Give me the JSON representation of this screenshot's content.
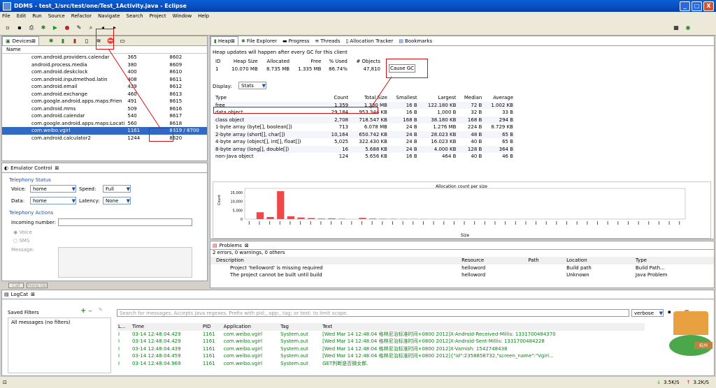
{
  "window": {
    "title": "DDMS - test_1/src/test/one/Test_1Activity.java - Eclipse",
    "min": "_",
    "max": "□",
    "close": "X"
  },
  "menu": [
    "File",
    "Edit",
    "Run",
    "Source",
    "Refactor",
    "Navigate",
    "Search",
    "Project",
    "Window",
    "Help"
  ],
  "devices": {
    "tab": "Devices",
    "col_name": "Name",
    "rows": [
      {
        "name": "com.android.providers.calendar",
        "pid": "365",
        "port": "8602"
      },
      {
        "name": "android.process.media",
        "pid": "380",
        "port": "8609"
      },
      {
        "name": "com.android.deskclock",
        "pid": "400",
        "port": "8610"
      },
      {
        "name": "com.android.inputmethod.latin",
        "pid": "408",
        "port": "8611"
      },
      {
        "name": "com.android.email",
        "pid": "439",
        "port": "8612"
      },
      {
        "name": "com.android.exchange",
        "pid": "460",
        "port": "8613"
      },
      {
        "name": "com.google.android.apps.maps:Frien",
        "pid": "491",
        "port": "8615"
      },
      {
        "name": "com.android.mms",
        "pid": "509",
        "port": "8616"
      },
      {
        "name": "com.android.calendar",
        "pid": "540",
        "port": "8617"
      },
      {
        "name": "com.google.android.apps.maps:Locati",
        "pid": "560",
        "port": "8618"
      },
      {
        "name": "com.weibo.vgirl",
        "pid": "1161",
        "port": "8619 / 8700"
      },
      {
        "name": "com.android.calculator2",
        "pid": "1244",
        "port": "8620"
      }
    ]
  },
  "emulator": {
    "tab": "Emulator Control",
    "telephony_status": "Telephony Status",
    "voice_label": "Voice:",
    "voice_value": "home",
    "speed_label": "Speed:",
    "speed_value": "Full",
    "data_label": "Data:",
    "data_value": "home",
    "latency_label": "Latency:",
    "latency_value": "None",
    "telephony_actions": "Telephony Actions",
    "incoming_label": "Incoming number:",
    "voice_radio": "Voice",
    "sms_radio": "SMS",
    "message_label": "Message:",
    "call_btn": "Call",
    "hangup_btn": "Hang Up"
  },
  "heap": {
    "tabs": [
      "Heap",
      "File Explorer",
      "Progress",
      "Threads",
      "Allocation Tracker",
      "Bookmarks"
    ],
    "notice": "Heap updates will happen after every GC for this client",
    "summary_headers": [
      "ID",
      "Heap Size",
      "Allocated",
      "Free",
      "% Used",
      "# Objects"
    ],
    "summary_row": [
      "1",
      "10.070 MB",
      "8.735 MB",
      "1.335 MB",
      "86.74%",
      "47,810"
    ],
    "cause_gc": "Cause GC",
    "display_label": "Display:",
    "display_value": "Stats",
    "headers": [
      "Type",
      "Count",
      "Total Size",
      "Smallest",
      "Largest",
      "Median",
      "Average"
    ],
    "rows": [
      [
        "free",
        "1,359",
        "1.330 MB",
        "16 B",
        "122.180 KB",
        "72 B",
        "1.002 KB"
      ],
      [
        "data object",
        "29,184",
        "953.344 KB",
        "16 B",
        "1,000 B",
        "32 B",
        "33 B"
      ],
      [
        "class object",
        "2,708",
        "718.547 KB",
        "168 B",
        "38.180 KB",
        "168 B",
        "294 B"
      ],
      [
        "1-byte array (byte[], boolean[])",
        "713",
        "6.078 MB",
        "24 B",
        "1.276 MB",
        "224 B",
        "8.729 KB"
      ],
      [
        "2-byte array (short[], char[])",
        "10,164",
        "650.742 KB",
        "24 B",
        "28.023 KB",
        "48 B",
        "65 B"
      ],
      [
        "4-byte array (object[], int[], float[])",
        "5,025",
        "322.430 KB",
        "24 B",
        "16.023 KB",
        "40 B",
        "65 B"
      ],
      [
        "8-byte array (long[], double[])",
        "16",
        "5.688 KB",
        "24 B",
        "4.000 KB",
        "128 B",
        "364 B"
      ],
      [
        "non-Java object",
        "124",
        "5.656 KB",
        "16 B",
        "464 B",
        "40 B",
        "46 B"
      ]
    ]
  },
  "alloc_chart": {
    "type": "bar",
    "title": "Allocation count per size",
    "xlabel": "Size",
    "ylabel": "Count",
    "yticks": [
      "15,000",
      "10,000",
      "5,000",
      "0"
    ],
    "chart_data": {
      "type": "bar",
      "values": [
        0,
        3800,
        1200,
        15500,
        1600,
        900,
        600,
        300,
        400,
        200,
        0,
        700,
        300,
        200,
        150,
        100,
        100,
        80,
        60,
        50,
        40,
        30,
        30,
        20,
        20,
        10,
        10,
        10,
        10,
        10,
        10,
        10,
        10,
        10,
        10,
        10,
        10,
        10,
        10,
        10,
        10,
        10,
        10
      ],
      "ylim": [
        0,
        17000
      ]
    }
  },
  "problems": {
    "tab": "Problems",
    "summary": "2 errors, 0 warnings, 0 others",
    "headers": [
      "Description",
      "Resource",
      "Path",
      "Location",
      "Type"
    ],
    "rows": [
      [
        "Project 'helloword' is missing required",
        "helloword",
        "",
        "Build path",
        "Build Path..."
      ],
      [
        "The project cannot be built until build",
        "helloword",
        "",
        "Unknown",
        "Java Problem"
      ]
    ]
  },
  "logcat": {
    "tab": "LogCat",
    "saved_filters": "Saved Filters",
    "all_messages": "All messages (no filters)",
    "search_placeholder": "Search for messages. Accepts Java regexes. Prefix with pid:, app:, tag: or text: to limit scope.",
    "level_value": "verbose",
    "headers": [
      "L...",
      "Time",
      "PID",
      "Application",
      "Tag",
      "Text"
    ],
    "rows": [
      [
        "I",
        "03-14 12:48:04.429",
        "1161",
        "com.weibo.vgirl",
        "System.out",
        "[Wed Mar 14 12:48:04 格林尼治标准时间+0800 2012]X-Android-Received-Millis: 1331700484370"
      ],
      [
        "I",
        "03-14 12:48:04.429",
        "1161",
        "com.weibo.vgirl",
        "System.out",
        "[Wed Mar 14 12:48:04 格林尼治标准时间+0800 2012]X-Android-Sent-Millis: 1331700484228"
      ],
      [
        "I",
        "03-14 12:48:04.439",
        "1161",
        "com.weibo.vgirl",
        "System.out",
        "[Wed Mar 14 12:48:04 格林尼治标准时间+0800 2012]X-Varnish: 1542748438"
      ],
      [
        "I",
        "03-14 12:48:04.459",
        "1161",
        "com.weibo.vgirl",
        "System.out",
        "[Wed Mar 14 12:48:04 格林尼治标准时间+0800 2012]{\"id\":2358858732,\"screen_name\":\"Vgirl..."
      ],
      [
        "I",
        "03-14 12:48:04.969",
        "1161",
        "com.weibo.vgirl",
        "System.out",
        "GET判断是否微女郎."
      ]
    ]
  },
  "status": {
    "down": "3.5K/S",
    "up": "3.2K/S",
    "city": "杭州"
  }
}
